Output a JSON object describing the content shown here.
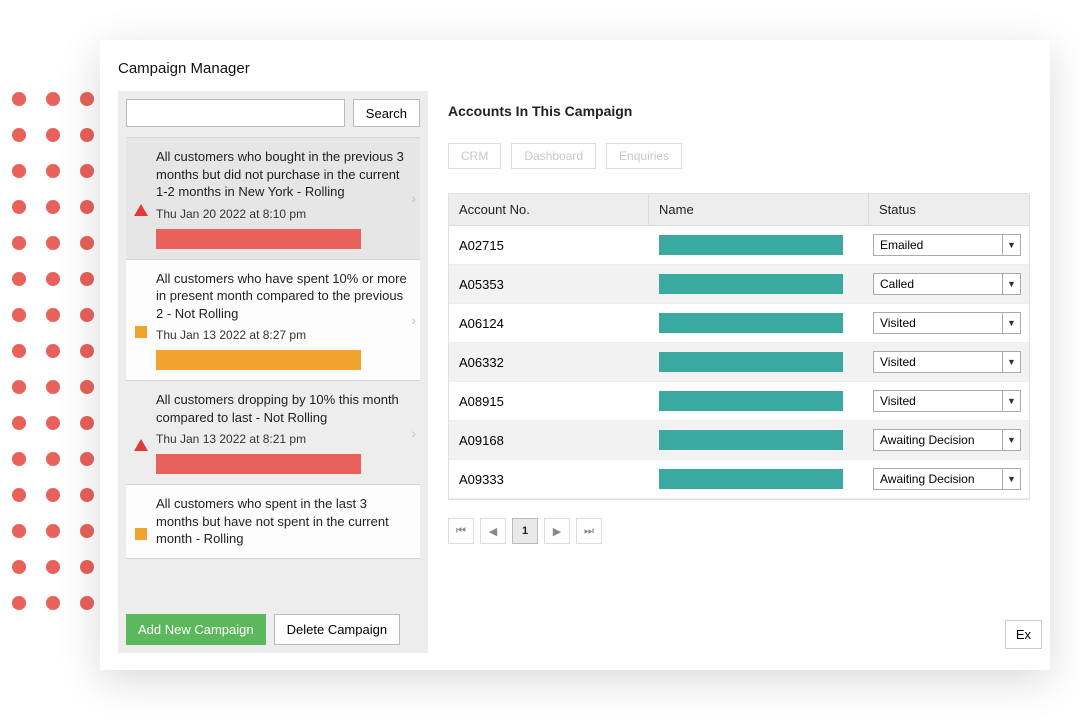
{
  "colors": {
    "accent_red": "#e8615a",
    "accent_orange": "#f2a32b",
    "accent_teal": "#3aa99f",
    "accent_green": "#5cb85c"
  },
  "app_title": "Campaign Manager",
  "search": {
    "value": "",
    "button_label": "Search"
  },
  "campaigns": [
    {
      "icon": "triangle-red",
      "title": "All customers who bought in the previous 3 months but did not purchase in the current 1-2 months in New York - Rolling",
      "date": "Thu Jan 20 2022 at 8:10 pm",
      "bar_color": "bar-red",
      "selected": true
    },
    {
      "icon": "square-orange",
      "title": "All customers who have spent 10% or more in present month compared to the previous 2 - Not Rolling",
      "date": "Thu Jan 13 2022 at 8:27 pm",
      "bar_color": "bar-orange",
      "selected": false
    },
    {
      "icon": "triangle-red",
      "title": "All customers dropping by 10% this month compared to last - Not Rolling",
      "date": "Thu Jan 13 2022 at 8:21 pm",
      "bar_color": "bar-red",
      "selected": false
    },
    {
      "icon": "square-orange",
      "title": "All customers who spent in the last 3 months but have not spent in the current month - Rolling",
      "date": "",
      "bar_color": "",
      "selected": false
    }
  ],
  "left_actions": {
    "add": "Add New Campaign",
    "delete": "Delete Campaign"
  },
  "right": {
    "title": "Accounts In This Campaign",
    "tabs": [
      "CRM",
      "Dashboard",
      "Enquiries"
    ],
    "columns": {
      "acc": "Account No.",
      "name": "Name",
      "status": "Status"
    },
    "rows": [
      {
        "acc": "A02715",
        "status": "Emailed"
      },
      {
        "acc": "A05353",
        "status": "Called"
      },
      {
        "acc": "A06124",
        "status": "Visited"
      },
      {
        "acc": "A06332",
        "status": "Visited"
      },
      {
        "acc": "A08915",
        "status": "Visited"
      },
      {
        "acc": "A09168",
        "status": "Awaiting Decision"
      },
      {
        "acc": "A09333",
        "status": "Awaiting Decision"
      }
    ],
    "pager": {
      "current": "1"
    },
    "export_label": "Ex"
  }
}
